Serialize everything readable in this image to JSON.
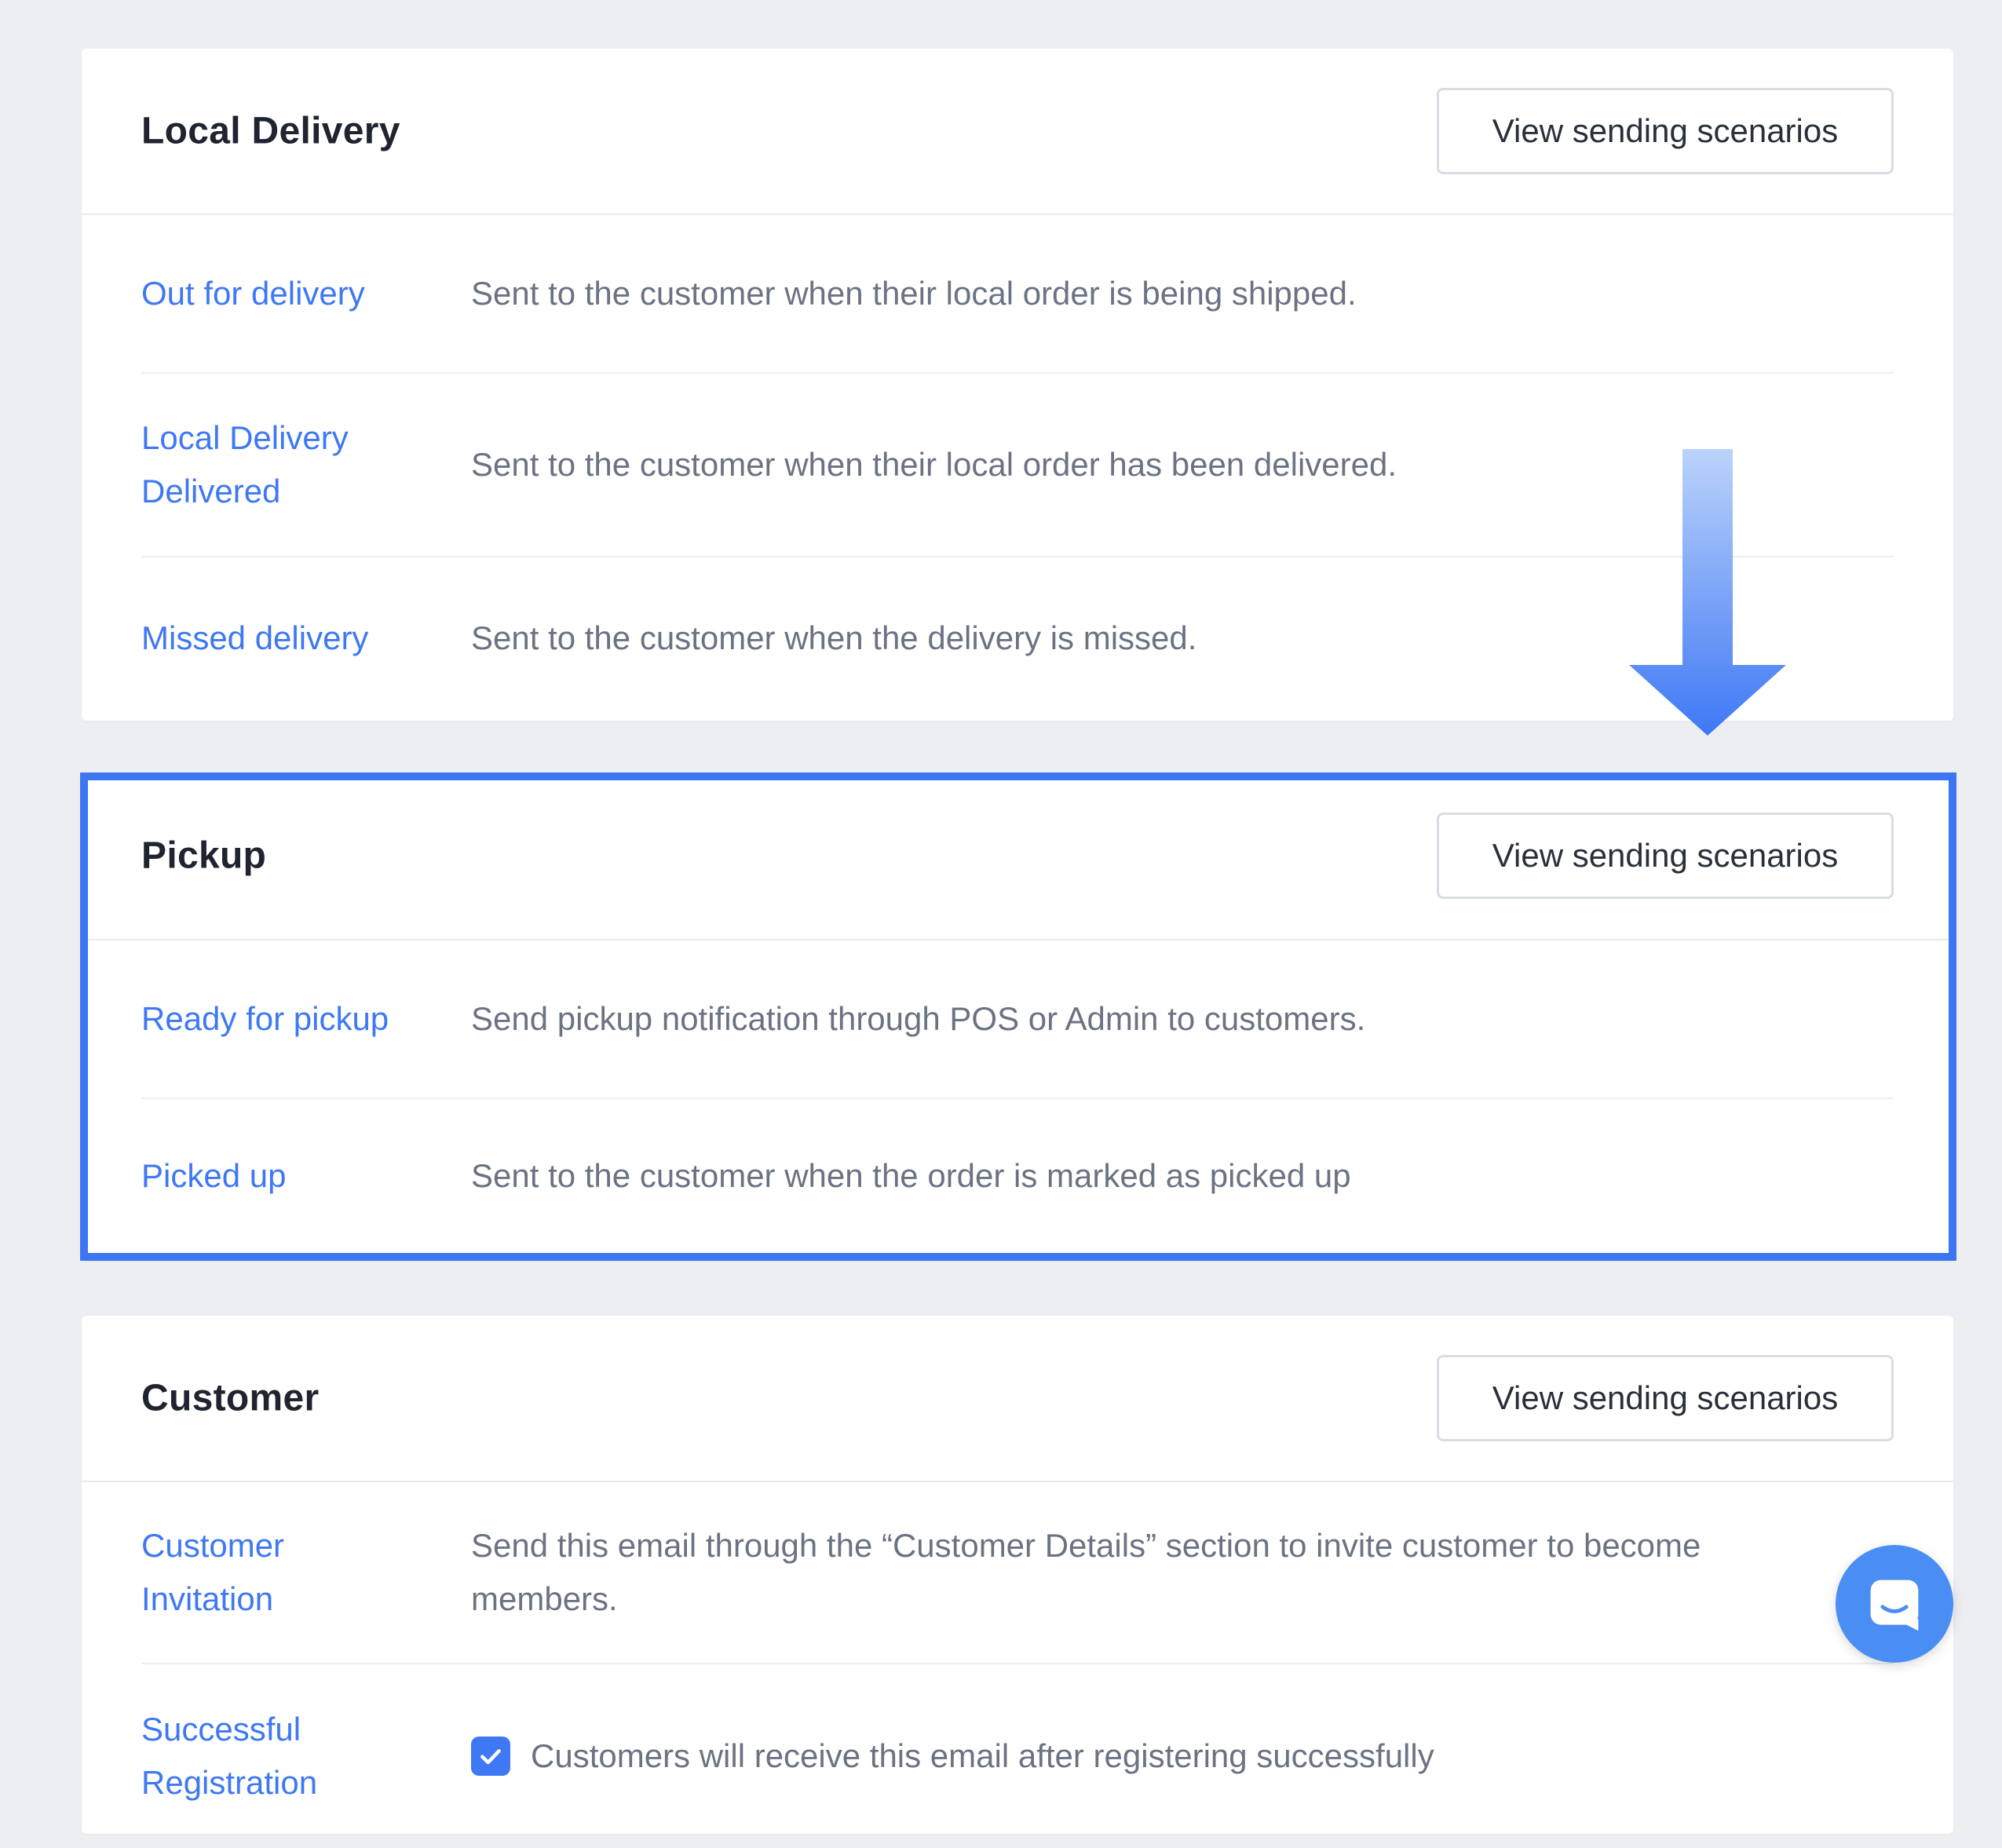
{
  "sections": [
    {
      "title": "Local Delivery",
      "button_label": "View sending scenarios",
      "rows": [
        {
          "link": "Out for delivery",
          "desc": "Sent to the customer when their local order is being shipped."
        },
        {
          "link": "Local Delivery Delivered",
          "desc": "Sent to the customer when their local order has been delivered."
        },
        {
          "link": "Missed delivery",
          "desc": "Sent to the customer when the delivery is missed."
        }
      ]
    },
    {
      "title": "Pickup",
      "button_label": "View sending scenarios",
      "rows": [
        {
          "link": "Ready for pickup",
          "desc": "Send pickup notification through POS or Admin to customers."
        },
        {
          "link": "Picked up",
          "desc": "Sent to the customer when the order is marked as picked up"
        }
      ]
    },
    {
      "title": "Customer",
      "button_label": "View sending scenarios",
      "rows": [
        {
          "link": "Customer Invitation",
          "desc": "Send this email through the “Customer Details” section to invite customer to become members."
        },
        {
          "link": "Successful Registration",
          "desc": "Customers will receive this email after registering successfully",
          "checkbox_checked": true
        }
      ]
    }
  ],
  "icons": {
    "arrow": "down-arrow-icon",
    "chat": "chat-icon",
    "check": "checkmark-icon"
  },
  "colors": {
    "accent": "#3e78f5",
    "highlight": "#3c76f3",
    "background": "#eceef2"
  }
}
